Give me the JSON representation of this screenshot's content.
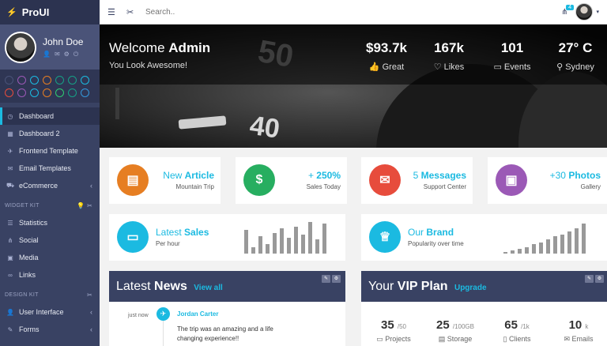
{
  "sidebar": {
    "brand": "ProUI",
    "user_name": "John Doe",
    "dot_colors": [
      "#4a5378",
      "#9b59b6",
      "#1bbae1",
      "#e67e22",
      "#16a085",
      "#16a085",
      "#1bbae1",
      "#e74c3c",
      "#9b59b6",
      "#1bbae1",
      "#e67e22",
      "#2ecc71",
      "#16a085",
      "#3498db"
    ],
    "nav": [
      {
        "label": "Dashboard",
        "icon": "timer-icon",
        "active": true
      },
      {
        "label": "Dashboard 2",
        "icon": "chart-icon"
      },
      {
        "label": "Frontend Template",
        "icon": "paper-plane-icon"
      },
      {
        "label": "Email Templates",
        "icon": "envelope-icon"
      },
      {
        "label": "eCommerce",
        "icon": "cart-icon",
        "chevron": true
      }
    ],
    "widget_kit_title": "WIDGET KIT",
    "widget_nav": [
      {
        "label": "Statistics",
        "icon": "list-icon"
      },
      {
        "label": "Social",
        "icon": "share-icon"
      },
      {
        "label": "Media",
        "icon": "picture-icon"
      },
      {
        "label": "Links",
        "icon": "link-icon"
      }
    ],
    "design_kit_title": "DESIGN KIT",
    "design_nav": [
      {
        "label": "User Interface",
        "icon": "user-icon",
        "chevron": true
      },
      {
        "label": "Forms",
        "icon": "pencil-icon",
        "chevron": true
      }
    ]
  },
  "topbar": {
    "search_placeholder": "Search..",
    "notification_count": "4"
  },
  "hero": {
    "welcome": "Welcome",
    "admin": "Admin",
    "subtitle": "You Look Awesome!",
    "stats": [
      {
        "value": "$93.7k",
        "label": "Great",
        "icon": "thumbs-up-icon"
      },
      {
        "value": "167k",
        "label": "Likes",
        "icon": "heart-icon"
      },
      {
        "value": "101",
        "label": "Events",
        "icon": "calendar-icon"
      },
      {
        "value": "27° C",
        "label": "Sydney",
        "icon": "location-icon"
      }
    ]
  },
  "cards": [
    {
      "pre": "New",
      "bold": "Article",
      "sub": "Mountain Trip",
      "color": "#e67e22",
      "icon": "document-icon",
      "glyph": "▤"
    },
    {
      "pre": "+",
      "bold": "250%",
      "sub": "Sales Today",
      "color": "#27ae60",
      "icon": "dollar-icon",
      "glyph": "$"
    },
    {
      "pre": "5",
      "bold": "Messages",
      "sub": "Support Center",
      "color": "#e74c3c",
      "icon": "envelope-icon",
      "glyph": "✉"
    },
    {
      "pre": "+30",
      "bold": "Photos",
      "sub": "Gallery",
      "color": "#9b59b6",
      "icon": "picture-icon",
      "glyph": "▣"
    }
  ],
  "widgets": [
    {
      "pre": "Latest",
      "bold": "Sales",
      "sub": "Per hour",
      "icon": "wallet-icon",
      "bars": [
        0.75,
        0.2,
        0.55,
        0.3,
        0.65,
        0.8,
        0.5,
        0.85,
        0.6,
        1.0,
        0.45,
        0.95
      ]
    },
    {
      "pre": "Our",
      "bold": "Brand",
      "sub": "Popularity over time",
      "icon": "crown-icon",
      "bars": [
        0.05,
        0.1,
        0.15,
        0.2,
        0.3,
        0.35,
        0.45,
        0.55,
        0.6,
        0.7,
        0.8,
        0.95
      ]
    }
  ],
  "news": {
    "title_pre": "Latest",
    "title_bold": "News",
    "link": "View all",
    "time": "just now",
    "name": "Jordan Carter",
    "text": "The trip was an amazing and a life changing experience!!"
  },
  "vip": {
    "title_pre": "Your",
    "title_bold": "VIP Plan",
    "link": "Upgrade",
    "items": [
      {
        "value": "35",
        "max": "/50",
        "label": "Projects",
        "icon": "folder-icon"
      },
      {
        "value": "25",
        "max": "/100GB",
        "label": "Storage",
        "icon": "hdd-icon"
      },
      {
        "value": "65",
        "max": "/1k",
        "label": "Clients",
        "icon": "phone-icon"
      },
      {
        "value": "10",
        "max": "k",
        "label": "Emails",
        "icon": "envelope-icon"
      }
    ]
  }
}
